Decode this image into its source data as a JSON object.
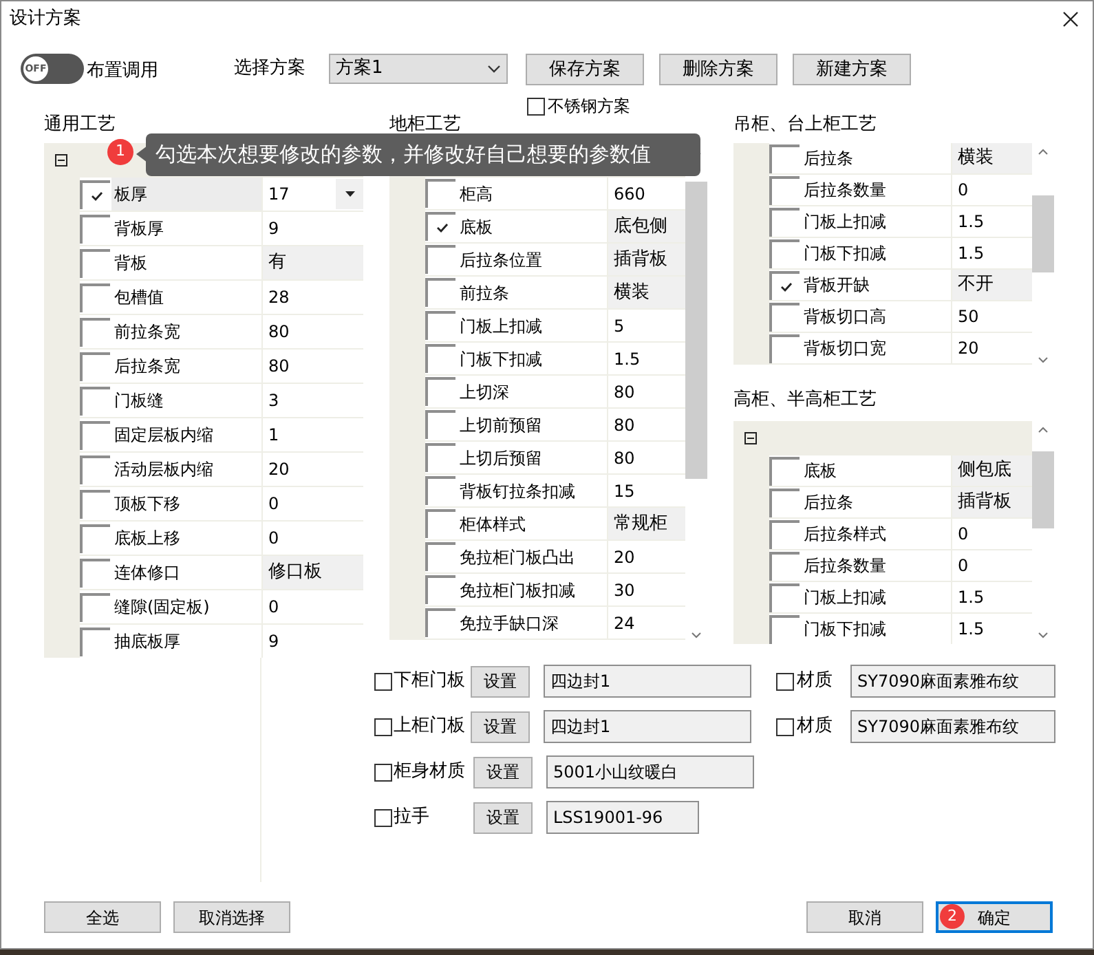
{
  "window": {
    "title": "设计方案"
  },
  "layout_toggle": {
    "label": "OFF",
    "on": false,
    "caption": "布置调用"
  },
  "scheme": {
    "label": "选择方案",
    "value": "方案1"
  },
  "scheme_buttons": [
    "保存方案",
    "删除方案",
    "新建方案"
  ],
  "stainless": {
    "label": "不锈钢方案",
    "checked": false
  },
  "tooltip": {
    "badge": "1",
    "text": "勾选本次想要修改的参数，并修改好自己想要的参数值"
  },
  "sections": [
    {
      "title": "通用工艺",
      "kind": "grouped",
      "expanded": true,
      "rows": [
        {
          "label": "板厚",
          "value": "17",
          "kind": "dropdown",
          "checked": true,
          "selected": true
        },
        {
          "label": "背板厚",
          "value": "9",
          "kind": "text",
          "checked": false,
          "selected": false
        },
        {
          "label": "背板",
          "value": "有",
          "kind": "choice",
          "checked": false,
          "selected": false
        },
        {
          "label": "包槽值",
          "value": "28",
          "kind": "text",
          "checked": false,
          "selected": false
        },
        {
          "label": "前拉条宽",
          "value": "80",
          "kind": "text",
          "checked": false,
          "selected": false
        },
        {
          "label": "后拉条宽",
          "value": "80",
          "kind": "text",
          "checked": false,
          "selected": false
        },
        {
          "label": "门板缝",
          "value": "3",
          "kind": "text",
          "checked": false,
          "selected": false
        },
        {
          "label": "固定层板内缩",
          "value": "1",
          "kind": "text",
          "checked": false,
          "selected": false
        },
        {
          "label": "活动层板内缩",
          "value": "20",
          "kind": "text",
          "checked": false,
          "selected": false
        },
        {
          "label": "顶板下移",
          "value": "0",
          "kind": "text",
          "checked": false,
          "selected": false
        },
        {
          "label": "底板上移",
          "value": "0",
          "kind": "text",
          "checked": false,
          "selected": false
        },
        {
          "label": "连体修口",
          "value": "修口板",
          "kind": "choice",
          "checked": false,
          "selected": false
        },
        {
          "label": "缝隙(固定板)",
          "value": "0",
          "kind": "text",
          "checked": false,
          "selected": false
        },
        {
          "label": "抽底板厚",
          "value": "9",
          "kind": "text",
          "checked": false,
          "selected": false
        }
      ]
    },
    {
      "title": "地柜工艺",
      "kind": "grouped",
      "scrollbar": true,
      "rows": [
        {
          "label": "柜高",
          "value": "660",
          "kind": "text",
          "checked": false,
          "selected": false
        },
        {
          "label": "底板",
          "value": "底包侧",
          "kind": "choice",
          "checked": true,
          "selected": false
        },
        {
          "label": "后拉条位置",
          "value": "插背板",
          "kind": "choice",
          "checked": false,
          "selected": false
        },
        {
          "label": "前拉条",
          "value": "横装",
          "kind": "choice",
          "checked": false,
          "selected": false
        },
        {
          "label": "门板上扣减",
          "value": "5",
          "kind": "text",
          "checked": false,
          "selected": false
        },
        {
          "label": "门板下扣减",
          "value": "1.5",
          "kind": "text",
          "checked": false,
          "selected": false
        },
        {
          "label": "上切深",
          "value": "80",
          "kind": "text",
          "checked": false,
          "selected": false
        },
        {
          "label": "上切前预留",
          "value": "80",
          "kind": "text",
          "checked": false,
          "selected": false
        },
        {
          "label": "上切后预留",
          "value": "80",
          "kind": "text",
          "checked": false,
          "selected": false
        },
        {
          "label": "背板钉拉条扣减",
          "value": "15",
          "kind": "text",
          "checked": false,
          "selected": false
        },
        {
          "label": "柜体样式",
          "value": "常规柜",
          "kind": "choice",
          "checked": false,
          "selected": false
        },
        {
          "label": "免拉柜门板凸出",
          "value": "20",
          "kind": "text",
          "checked": false,
          "selected": false
        },
        {
          "label": "免拉柜门板扣减",
          "value": "30",
          "kind": "text",
          "checked": false,
          "selected": false
        },
        {
          "label": "免拉手缺口深",
          "value": "24",
          "kind": "text",
          "checked": false,
          "selected": false
        }
      ]
    },
    {
      "title": "吊柜、台上柜工艺",
      "kind": "flat",
      "scrollbar": true,
      "rows": [
        {
          "label": "后拉条",
          "value": "横装",
          "kind": "choice",
          "checked": false,
          "selected": false
        },
        {
          "label": "后拉条数量",
          "value": "0",
          "kind": "text",
          "checked": false,
          "selected": false
        },
        {
          "label": "门板上扣减",
          "value": "1.5",
          "kind": "text",
          "checked": false,
          "selected": false
        },
        {
          "label": "门板下扣减",
          "value": "1.5",
          "kind": "text",
          "checked": false,
          "selected": false
        },
        {
          "label": "背板开缺",
          "value": "不开",
          "kind": "choice",
          "checked": true,
          "selected": false
        },
        {
          "label": "背板切口高",
          "value": "50",
          "kind": "text",
          "checked": false,
          "selected": false
        },
        {
          "label": "背板切口宽",
          "value": "20",
          "kind": "text",
          "checked": false,
          "selected": false
        }
      ]
    },
    {
      "title": "高柜、半高柜工艺",
      "kind": "grouped",
      "expanded": true,
      "scrollbar": true,
      "rows": [
        {
          "label": "底板",
          "value": "侧包底",
          "kind": "choice",
          "checked": false,
          "selected": false
        },
        {
          "label": "后拉条",
          "value": "插背板",
          "kind": "choice",
          "checked": false,
          "selected": false
        },
        {
          "label": "后拉条样式",
          "value": "0",
          "kind": "text",
          "checked": false,
          "selected": false
        },
        {
          "label": "后拉条数量",
          "value": "0",
          "kind": "text",
          "checked": false,
          "selected": false
        },
        {
          "label": "门板上扣减",
          "value": "1.5",
          "kind": "text",
          "checked": false,
          "selected": false
        },
        {
          "label": "门板下扣减",
          "value": "1.5",
          "kind": "text",
          "checked": false,
          "selected": false
        }
      ]
    }
  ],
  "materials": [
    {
      "label": "下柜门板",
      "checked": false,
      "button": "设置",
      "value": "四边封1",
      "material": {
        "label": "材质",
        "checked": false,
        "value": "SY7090麻面素雅布纹"
      }
    },
    {
      "label": "上柜门板",
      "checked": false,
      "button": "设置",
      "value": "四边封1",
      "material": {
        "label": "材质",
        "checked": false,
        "value": "SY7090麻面素雅布纹"
      }
    },
    {
      "label": "柜身材质",
      "checked": false,
      "button": "设置",
      "value": "5001小山纹暖白"
    },
    {
      "label": "拉手",
      "checked": false,
      "button": "设置",
      "value": "LSS19001-96"
    }
  ],
  "footer_left": [
    {
      "label": "全选"
    },
    {
      "label": "取消选择"
    }
  ],
  "footer_right": [
    {
      "label": "取消",
      "default": false
    },
    {
      "label": "确定",
      "default": true,
      "badge": "2"
    }
  ]
}
